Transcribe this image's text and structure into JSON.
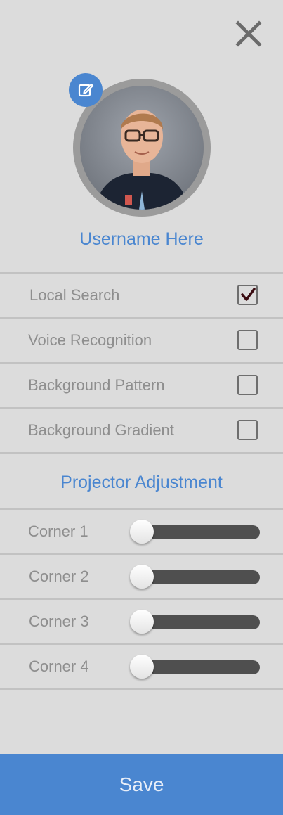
{
  "header": {
    "close_icon": "close-icon",
    "edit_icon": "edit-icon"
  },
  "profile": {
    "username": "Username Here"
  },
  "settings": [
    {
      "label": "Local Search",
      "checked": true
    },
    {
      "label": "Voice Recognition",
      "checked": false
    },
    {
      "label": "Background Pattern",
      "checked": false
    },
    {
      "label": "Background Gradient",
      "checked": false
    }
  ],
  "projector": {
    "title": "Projector Adjustment",
    "corners": [
      {
        "label": "Corner 1",
        "value": 0
      },
      {
        "label": "Corner 2",
        "value": 0
      },
      {
        "label": "Corner 3",
        "value": 0
      },
      {
        "label": "Corner 4",
        "value": 0
      }
    ]
  },
  "footer": {
    "save_label": "Save"
  },
  "colors": {
    "accent": "#4a86d0",
    "background": "#dcdcdc",
    "check": "#3a0a10"
  }
}
